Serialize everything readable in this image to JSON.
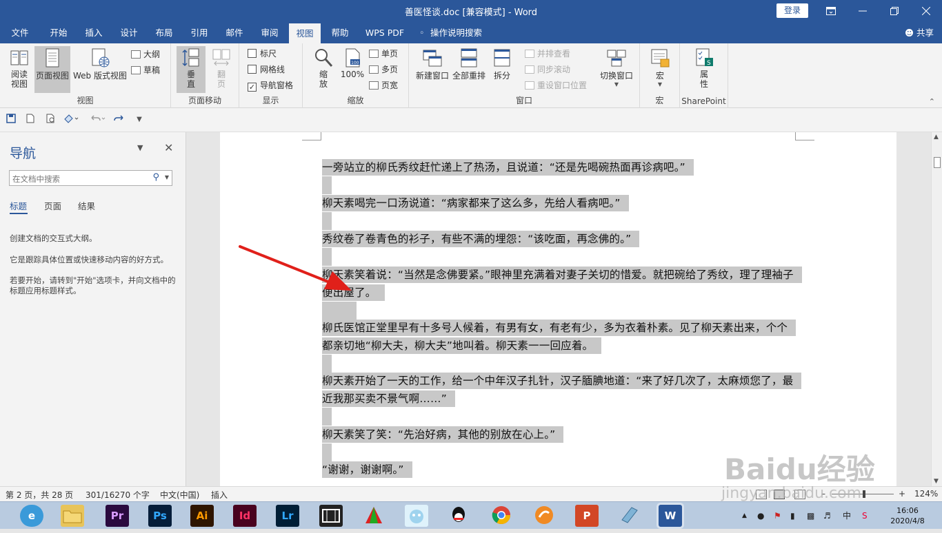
{
  "window": {
    "title": "善医怪谈.doc [兼容模式]  -  Word",
    "login": "登录",
    "controls": [
      "ribbon-display",
      "minimize",
      "restore",
      "close"
    ]
  },
  "tabs": [
    "文件",
    "开始",
    "插入",
    "设计",
    "布局",
    "引用",
    "邮件",
    "审阅",
    "视图",
    "帮助",
    "WPS PDF",
    "操作说明搜索"
  ],
  "active_tab": "视图",
  "share": "共享",
  "ribbon": {
    "view_group": {
      "label": "视图",
      "read_mode": "阅读\n视图",
      "print_layout": "页面视图",
      "web_layout": "Web 版式视图",
      "outline": "大纲",
      "draft": "草稿"
    },
    "page_move_group": {
      "label": "页面移动",
      "vertical": "垂\n直",
      "side_to_side": "翻\n页"
    },
    "show_group": {
      "label": "显示",
      "ruler": "标尺",
      "gridlines": "网格线",
      "nav_pane": "导航窗格",
      "ruler_checked": false,
      "gridlines_checked": false,
      "nav_pane_checked": true
    },
    "zoom_group": {
      "label": "缩放",
      "zoom": "缩\n放",
      "hundred": "100%",
      "one_page": "单页",
      "multi_page": "多页",
      "page_width": "页宽"
    },
    "window_group": {
      "label": "窗口",
      "new_window": "新建窗口",
      "arrange_all": "全部重排",
      "split": "拆分",
      "side_by_side": "并排查看",
      "sync_scroll": "同步滚动",
      "reset_pos": "重设窗口位置",
      "switch_windows": "切换窗口"
    },
    "macro_group": {
      "label": "宏",
      "macro": "宏"
    },
    "sharepoint_group": {
      "label": "SharePoint",
      "properties": "属\n性"
    }
  },
  "nav_pane": {
    "title": "导航",
    "search_placeholder": "在文档中搜索",
    "tabs": [
      "标题",
      "页面",
      "结果"
    ],
    "active_tab": "标题",
    "help": [
      "创建文档的交互式大纲。",
      "它是跟踪具体位置或快速移动内容的好方式。",
      "若要开始，请转到\"开始\"选项卡，并向文档中的标题应用标题样式。"
    ]
  },
  "document": {
    "paragraphs": [
      "一旁站立的柳氏秀纹赶忙递上了热汤，且说道：“还是先喝碗热面再诊病吧。”",
      "柳天素喝完一口汤说道：“病家都来了这么多，先给人看病吧。”",
      "秀纹卷了卷青色的衫子，有些不满的埋怨：“该吃面，再念佛的。”",
      "柳天素笑着说：“当然是念佛要紧。”眼神里充满着对妻子关切的惜爱。就把碗给了秀纹，理了理袖子便出屋了。",
      "柳氏医馆正堂里早有十多号人候着，有男有女，有老有少，多为衣着朴素。见了柳天素出来，个个都亲切地“柳大夫，柳大夫”地叫着。柳天素一一回应着。",
      "柳天素开始了一天的工作，给一个中年汉子扎针，汉子腼腆地道：“来了好几次了，太麻烦您了，最近我那买卖不景气啊……”",
      "柳天素笑了笑：“先治好病，其他的别放在心上。”",
      "“谢谢，谢谢啊。”"
    ]
  },
  "status_bar": {
    "page": "第 2 页，共 28 页",
    "words": "301/16270 个字",
    "language": "中文(中国)",
    "mode": "插入",
    "zoom": "124%"
  },
  "taskbar": {
    "apps": [
      "browser",
      "file-explorer",
      "premiere",
      "photoshop",
      "illustrator",
      "indesign",
      "lightroom",
      "video-editor",
      "app-a",
      "app-b",
      "qq",
      "chrome",
      "app-c",
      "powerpoint",
      "app-d",
      "word"
    ],
    "app_labels": {
      "premiere": "Pr",
      "photoshop": "Ps",
      "illustrator": "Ai",
      "indesign": "Id",
      "lightroom": "Lr",
      "powerpoint": "P",
      "word": "W"
    },
    "ime": "中",
    "time": "16:06",
    "date": "2020/4/8"
  },
  "watermark": {
    "line1": "Baidu经验",
    "line2": "jingyan.baidu.com"
  },
  "colors": {
    "word_blue": "#2b579a",
    "selection": "#c8c8c8",
    "arrow": "#e0201a"
  }
}
